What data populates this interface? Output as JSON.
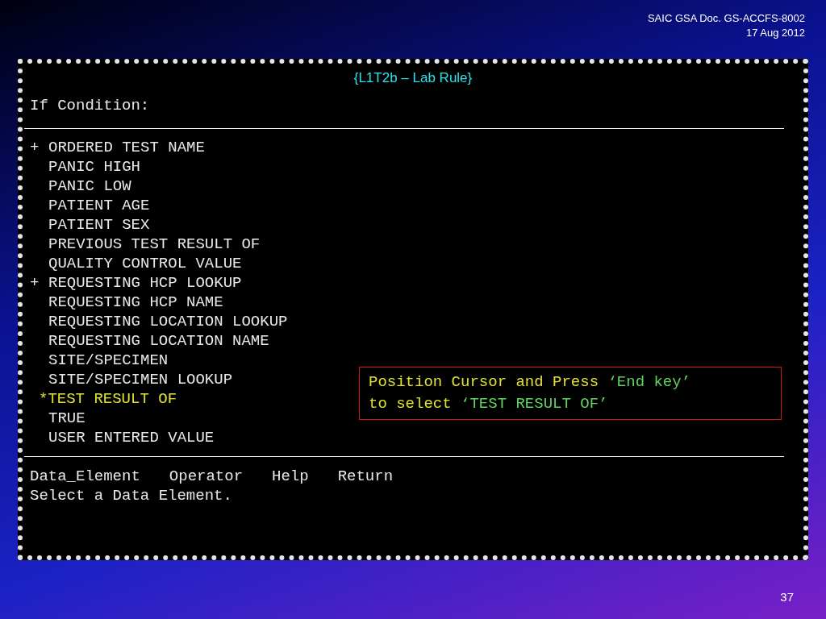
{
  "slide_header": {
    "lines": [
      "SAIC GSA Doc. GS-ACCFS-8002",
      "17 Aug 2012"
    ]
  },
  "terminal": {
    "title": "{L1T2b – Lab Rule}",
    "prompt": "If Condition:",
    "items": [
      {
        "prefix": "+",
        "label": "ORDERED TEST NAME",
        "selected": false
      },
      {
        "label": "PANIC HIGH",
        "selected": false
      },
      {
        "label": "PANIC LOW",
        "selected": false
      },
      {
        "label": "PATIENT AGE",
        "selected": false
      },
      {
        "label": "PATIENT SEX",
        "selected": false
      },
      {
        "label": "PREVIOUS TEST RESULT OF",
        "selected": false
      },
      {
        "label": "QUALITY CONTROL VALUE",
        "selected": false
      },
      {
        "prefix": "+",
        "label": "REQUESTING HCP LOOKUP",
        "selected": false
      },
      {
        "label": "REQUESTING HCP NAME",
        "selected": false
      },
      {
        "label": "REQUESTING LOCATION LOOKUP",
        "selected": false
      },
      {
        "label": "REQUESTING LOCATION NAME",
        "selected": false
      },
      {
        "label": "SITE/SPECIMEN",
        "selected": false
      },
      {
        "label": "SITE/SPECIMEN LOOKUP",
        "selected": false
      },
      {
        "prefix": "*",
        "label": "TEST RESULT OF",
        "selected": true
      },
      {
        "label": "TRUE",
        "selected": false
      },
      {
        "label": "USER ENTERED VALUE",
        "selected": false
      }
    ],
    "menu": [
      "Data_Element",
      "Operator",
      "Help",
      "Return"
    ],
    "status": "Select a Data Element."
  },
  "callout": {
    "lines": [
      [
        {
          "kind": "plain",
          "text": "Position Cursor and Press "
        },
        {
          "kind": "key",
          "text": "‘End key’"
        }
      ],
      [
        {
          "kind": "plain",
          "text": "to select "
        },
        {
          "kind": "key",
          "text": "‘TEST RESULT OF’"
        }
      ]
    ]
  },
  "slide_number": "37"
}
